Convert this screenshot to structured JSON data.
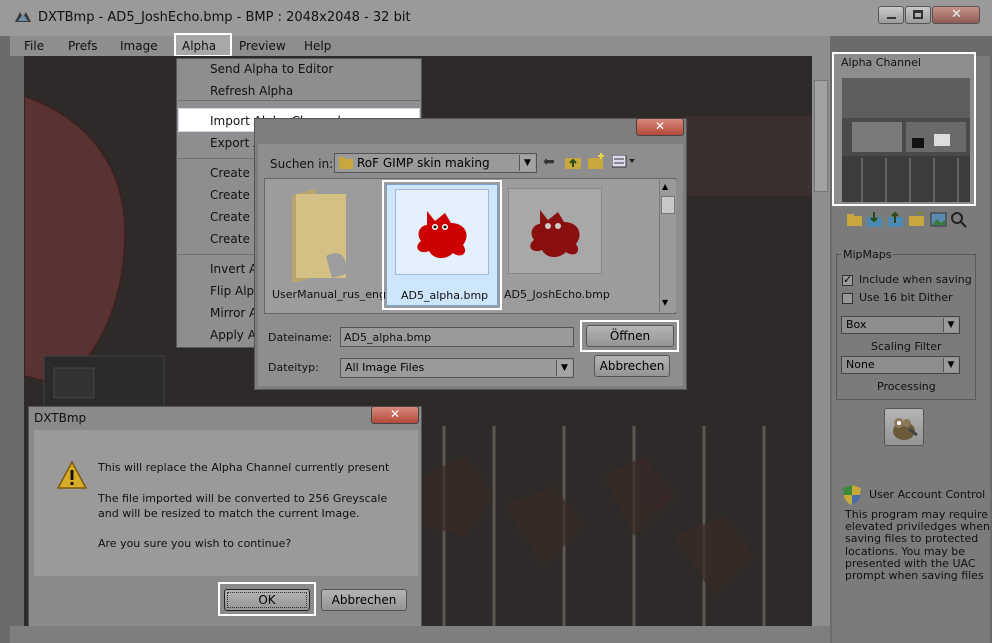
{
  "window": {
    "title": "DXTBmp - AD5_JoshEcho.bmp - BMP : 2048x2048 - 32 bit"
  },
  "menubar": {
    "items": [
      "File",
      "Prefs",
      "Image",
      "Alpha",
      "Preview",
      "Help"
    ]
  },
  "alpha_menu": {
    "items": [
      "Send Alpha to Editor",
      "Refresh Alpha",
      "Import Alpha Channel",
      "Export A",
      "Create A",
      "Create A",
      "Create A",
      "Create A",
      "Invert Al",
      "Flip Alph",
      "Mirror A",
      "Apply Al"
    ],
    "highlighted": "Import Alpha Channel"
  },
  "side_panel": {
    "alpha_channel_label": "Alpha Channel",
    "toolbar_icons": [
      "open-folder-icon",
      "import-icon",
      "export-icon",
      "folder-icon",
      "image-icon",
      "zoom-icon"
    ],
    "mipmaps": {
      "label": "MipMaps",
      "include_when_saving": {
        "label": "Include when saving",
        "checked": true
      },
      "use_16bit_dither": {
        "label": "Use 16 bit Dither",
        "checked": false
      },
      "scaling_filter": {
        "value": "Box",
        "label": "Scaling Filter"
      },
      "processing": {
        "value": "None",
        "label": "Processing"
      }
    },
    "uac": {
      "title": "User Account Control",
      "lines": [
        "This program may require",
        "elevated priviledges when",
        "saving files to protected",
        "locations. You may be",
        "presented with the UAC",
        "prompt when saving files"
      ]
    }
  },
  "file_dialog": {
    "look_in_label": "Suchen in:",
    "look_in_value": "RoF GIMP skin making",
    "files": [
      {
        "name": "UserManual_rus_eng",
        "type": "folder"
      },
      {
        "name": "AD5_alpha.bmp",
        "type": "image",
        "selected": true
      },
      {
        "name": "AD5_JoshEcho.bmp",
        "type": "image"
      }
    ],
    "filename_label": "Dateiname:",
    "filename_value": "AD5_alpha.bmp",
    "filetype_label": "Dateityp:",
    "filetype_value": "All Image Files",
    "open_button": "Öffnen",
    "cancel_button": "Abbrechen"
  },
  "confirm_dialog": {
    "title": "DXTBmp",
    "line1": "This will replace the  Alpha Channel currently present",
    "line2": "The file imported will be converted to 256 Greyscale",
    "line3": "and will be resized to match the current Image.",
    "line4": "Are you sure you wish to continue?",
    "ok_button": "OK",
    "cancel_button": "Abbrechen"
  },
  "colors": {
    "highlight": "#ffffff",
    "selection": "#cde6fb",
    "close_button": "#c0392b",
    "gimp_red": "#cc0000"
  }
}
